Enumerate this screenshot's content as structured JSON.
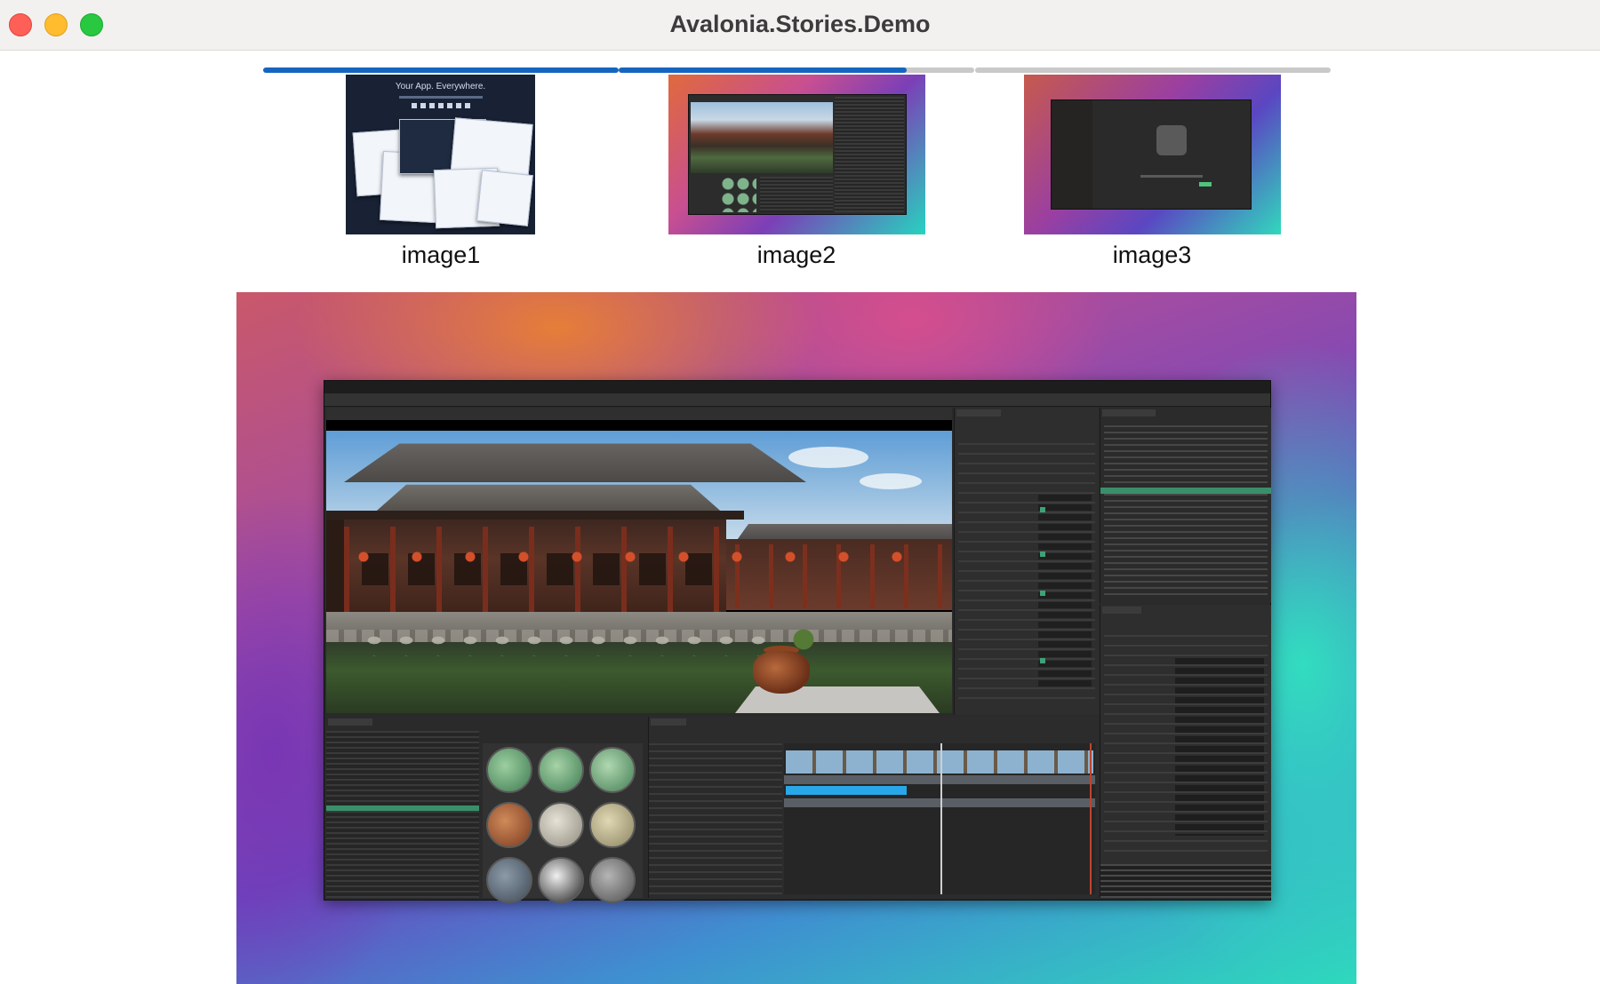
{
  "window": {
    "title": "Avalonia.Stories.Demo"
  },
  "stories": {
    "progress": [
      1.0,
      0.81,
      0.0
    ],
    "items": [
      {
        "label": "image1",
        "tagline": "Your App. Everywhere."
      },
      {
        "label": "image2"
      },
      {
        "label": "image3"
      }
    ]
  },
  "colors": {
    "progress_fill": "#1565c0",
    "progress_track": "#c9c9c9",
    "close": "#fe5f57",
    "minimize": "#febc2e",
    "maximize": "#28c840"
  }
}
